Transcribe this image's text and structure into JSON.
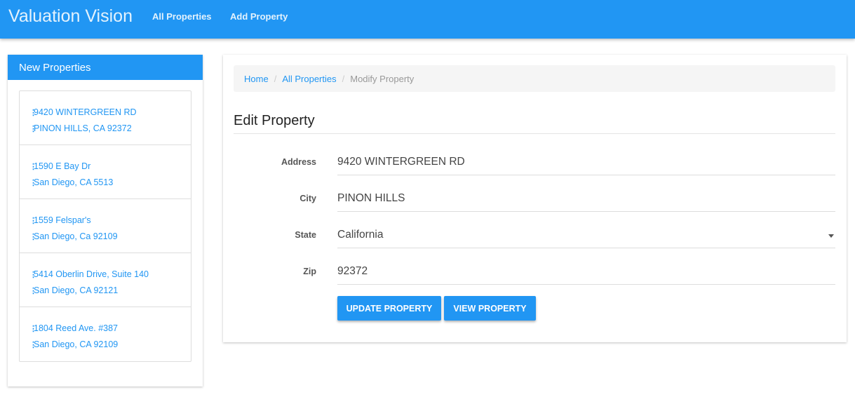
{
  "navbar": {
    "brand": "Valuation Vision",
    "links": [
      "All Properties",
      "Add Property"
    ]
  },
  "sidebar": {
    "title": "New Properties",
    "items": [
      {
        "line1": "9420 WINTERGREEN RD",
        "line2": "PINON HILLS, CA 92372"
      },
      {
        "line1": "1590 E Bay Dr",
        "line2": "San Diego, CA 5513"
      },
      {
        "line1": "1559 Felspar's",
        "line2": "San Diego, Ca 92109"
      },
      {
        "line1": "5414 Oberlin Drive, Suite 140",
        "line2": "San Diego, CA 92121"
      },
      {
        "line1": "1804 Reed Ave. #387",
        "line2": "San Diego, CA 92109"
      }
    ]
  },
  "breadcrumb": {
    "home": "Home",
    "all": "All Properties",
    "current": "Modify Property",
    "separator": "/"
  },
  "form": {
    "title": "Edit Property",
    "address_label": "Address",
    "address_value": "9420 WINTERGREEN RD",
    "city_label": "City",
    "city_value": "PINON HILLS",
    "state_label": "State",
    "state_value": "California",
    "zip_label": "Zip",
    "zip_value": "92372",
    "update_button": "UPDATE PROPERTY",
    "view_button": "VIEW PROPERTY"
  },
  "colors": {
    "primary": "#2196f3",
    "nav_text": "#e3f2fd"
  },
  "icons": {
    "list_marker": "vertical-dots-icon",
    "select_caret": "caret-down-icon"
  }
}
